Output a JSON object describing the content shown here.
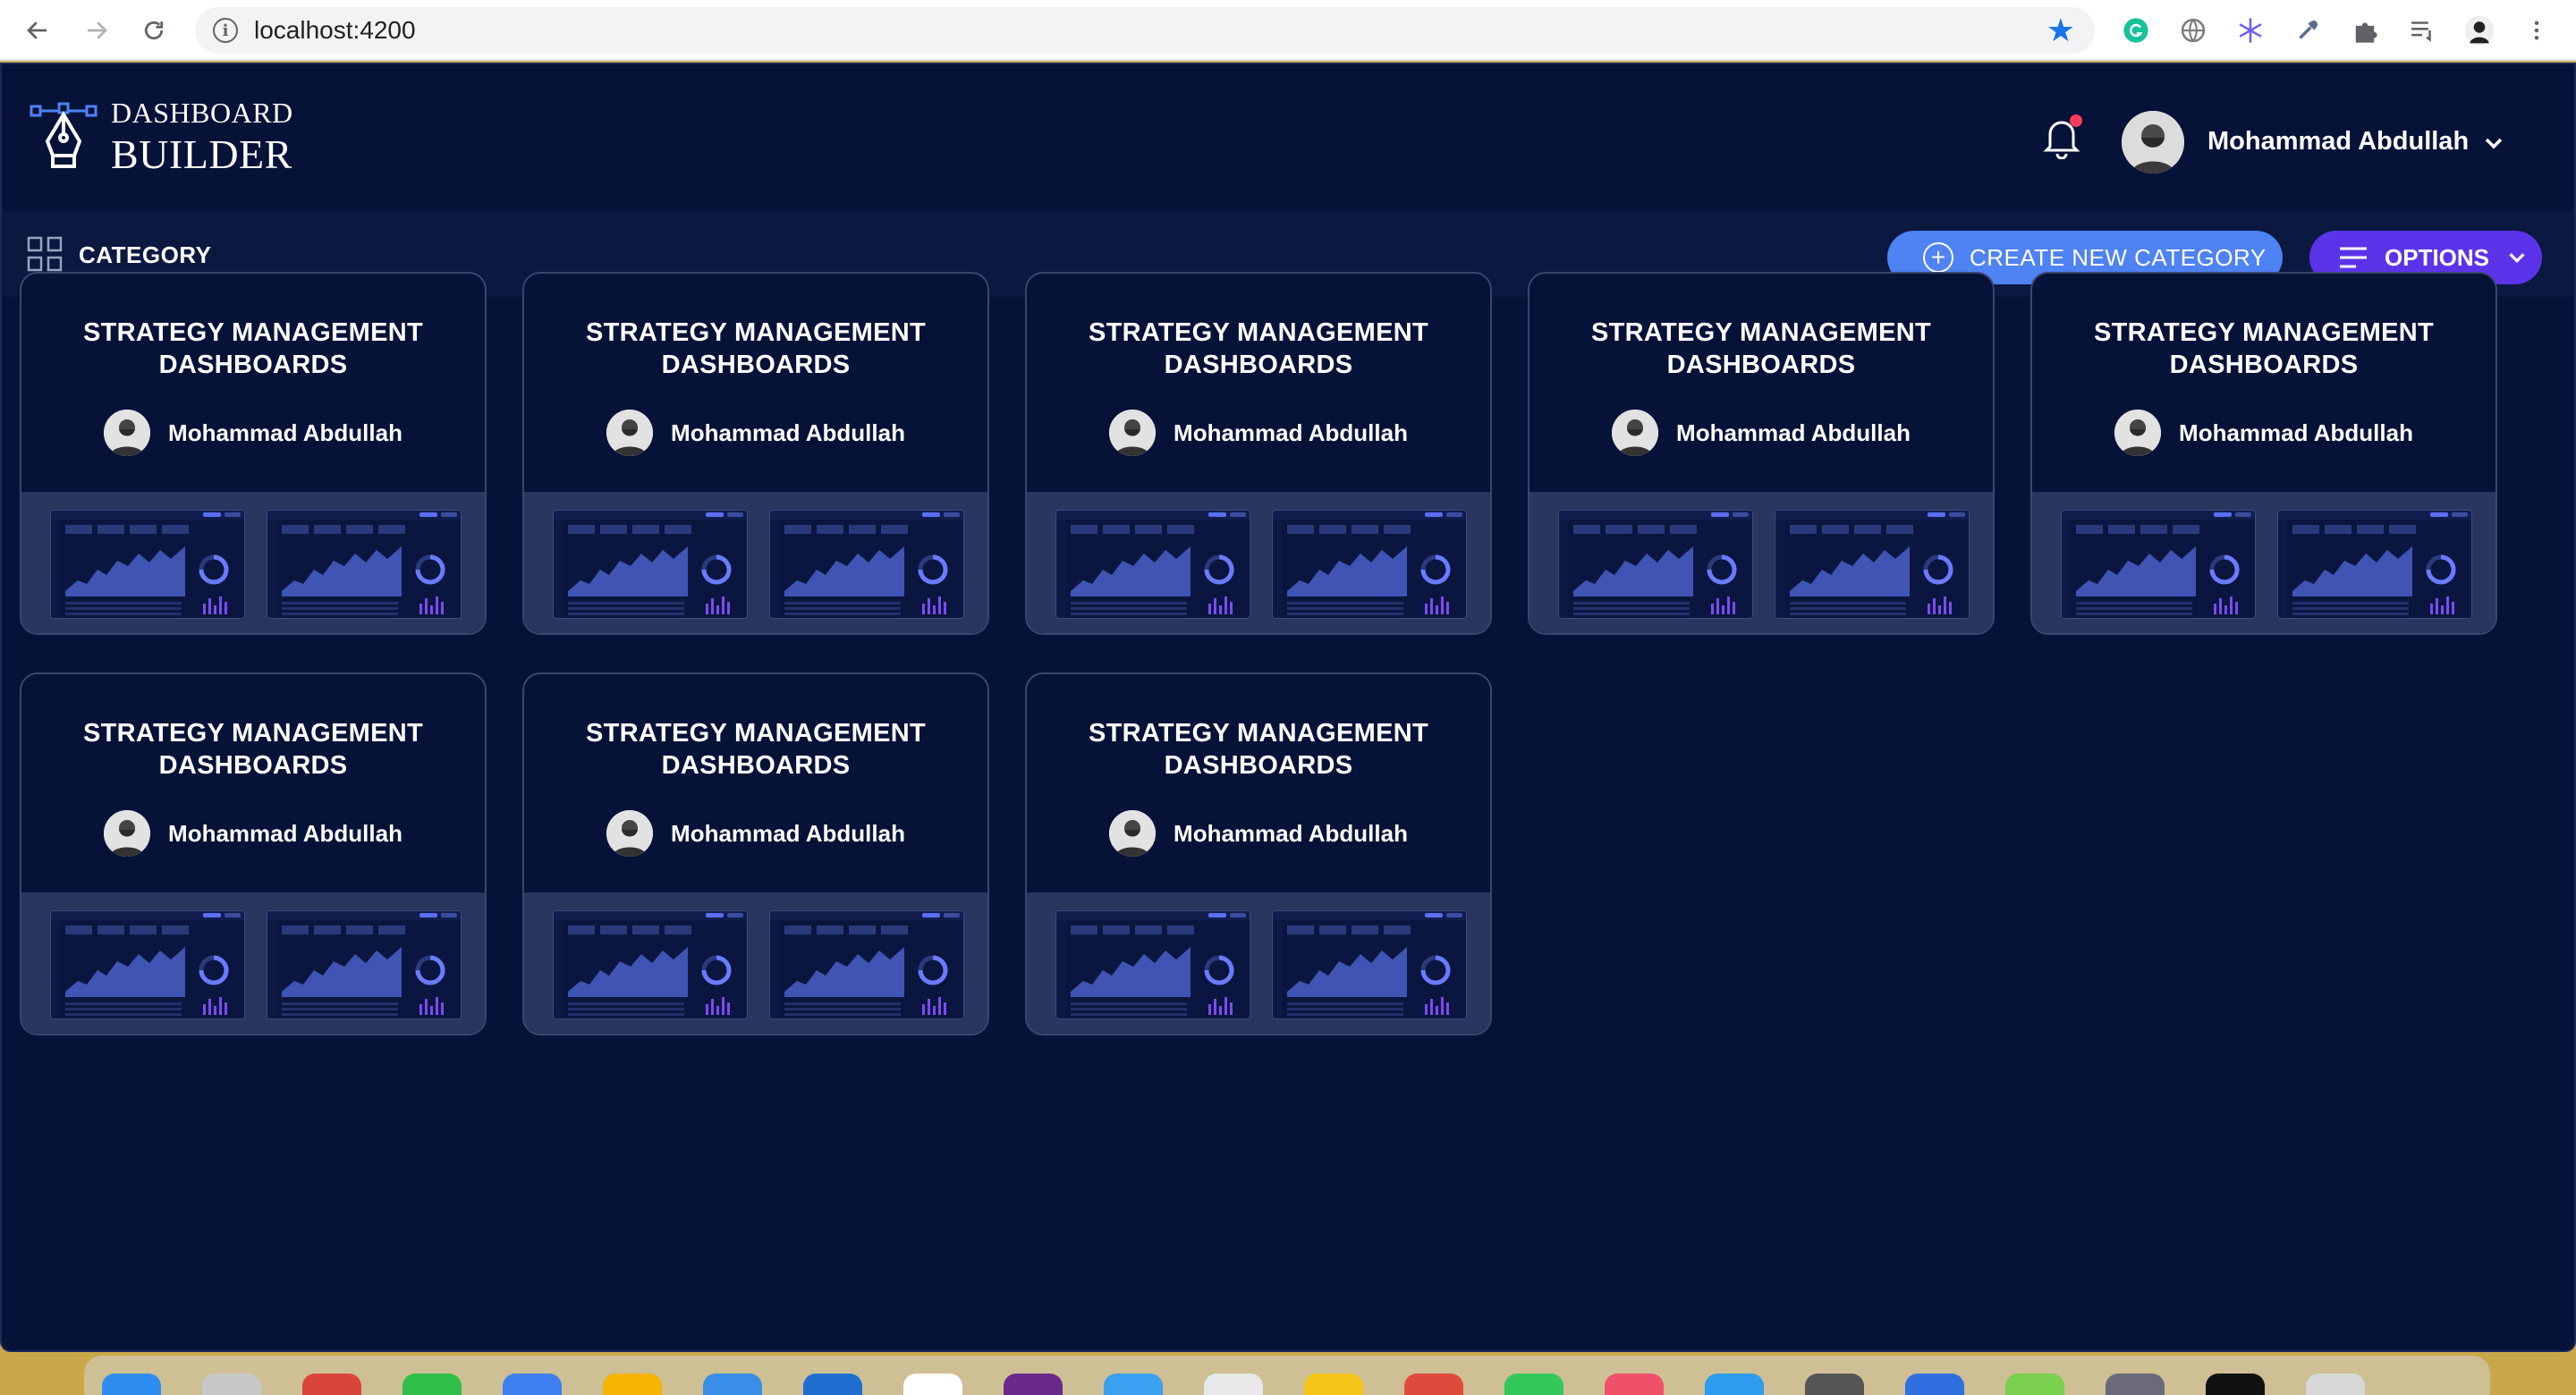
{
  "browser": {
    "url": "localhost:4200",
    "nav": [
      "back-icon",
      "forward-icon",
      "reload-icon"
    ],
    "extensions": [
      "grammarly-icon",
      "globe-icon",
      "snowflake-icon",
      "eyedropper-icon",
      "puzzle-icon",
      "reading-list-icon",
      "profile-avatar",
      "more-icon"
    ]
  },
  "app": {
    "logo": {
      "top": "DASHBOARD",
      "bottom": "BUILDER"
    },
    "user": {
      "name": "Mohammad Abdullah"
    },
    "toolbar": {
      "section": "CATEGORY",
      "create_label": "CREATE NEW CATEGORY",
      "options_label": "OPTIONS"
    },
    "cards": [
      {
        "title_line1": "STRATEGY MANAGEMENT",
        "title_line2": "DASHBOARDS",
        "author": "Mohammad Abdullah"
      },
      {
        "title_line1": "STRATEGY MANAGEMENT",
        "title_line2": "DASHBOARDS",
        "author": "Mohammad Abdullah"
      },
      {
        "title_line1": "STRATEGY MANAGEMENT",
        "title_line2": "DASHBOARDS",
        "author": "Mohammad Abdullah"
      },
      {
        "title_line1": "STRATEGY MANAGEMENT",
        "title_line2": "DASHBOARDS",
        "author": "Mohammad Abdullah"
      },
      {
        "title_line1": "STRATEGY MANAGEMENT",
        "title_line2": "DASHBOARDS",
        "author": "Mohammad Abdullah"
      },
      {
        "title_line1": "STRATEGY MANAGEMENT",
        "title_line2": "DASHBOARDS",
        "author": "Mohammad Abdullah"
      },
      {
        "title_line1": "STRATEGY MANAGEMENT",
        "title_line2": "DASHBOARDS",
        "author": "Mohammad Abdullah"
      },
      {
        "title_line1": "STRATEGY MANAGEMENT",
        "title_line2": "DASHBOARDS",
        "author": "Mohammad Abdullah"
      }
    ]
  },
  "colors": {
    "app_bg": "#061237",
    "toolbar_bg": "#0b1840",
    "create_btn": "#4f82f3",
    "options_btn": "#5b34ea",
    "card_border": "#3a4670",
    "preview_bg": "#2a3560",
    "notification_dot": "#ff3b5c"
  }
}
